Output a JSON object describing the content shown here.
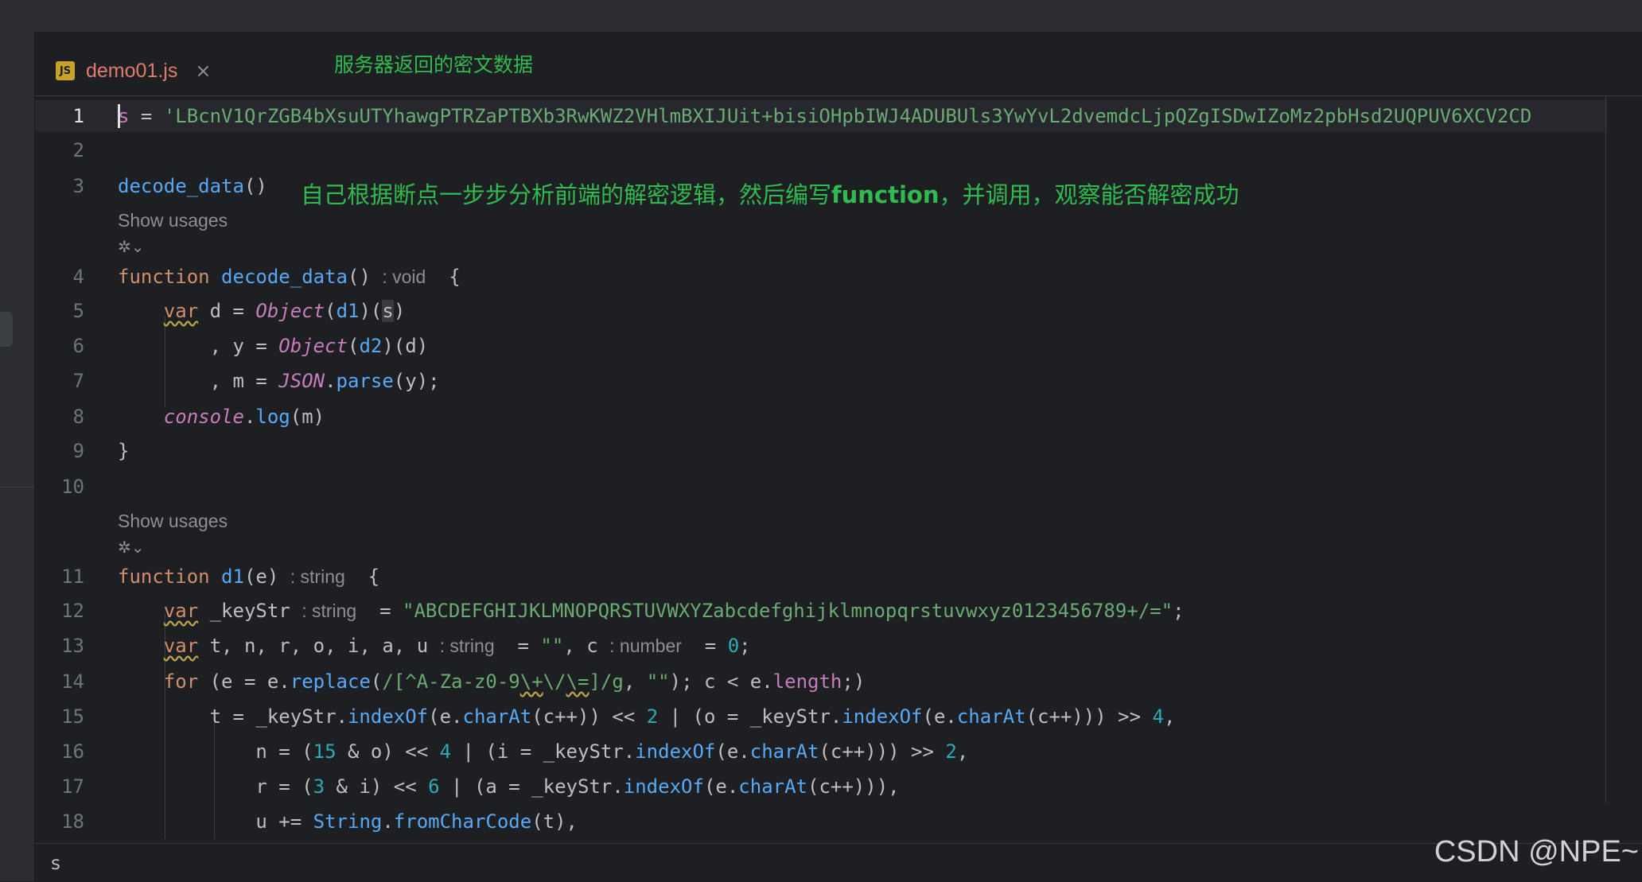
{
  "editor": {
    "tab": {
      "icon": "JS",
      "label": "demo01.js",
      "close": "×"
    },
    "status_text": "s"
  },
  "annotations": {
    "server_data": "服务器返回的密文数据",
    "line3_prefix": "自己根据断点一步步分析前端的解密逻辑，然后编写",
    "line3_bold": "function",
    "line3_suffix": "，并调用，观察能否解密成功"
  },
  "inlays": {
    "show_usages": "Show usages",
    "void": ": void",
    "string": ": string",
    "number": ": number"
  },
  "line_numbers": [
    "1",
    "2",
    "3",
    "4",
    "5",
    "6",
    "7",
    "8",
    "9",
    "10",
    "11",
    "12",
    "13",
    "14",
    "15",
    "16",
    "17",
    "18"
  ],
  "code": {
    "l1_var": "s",
    "l1_str": "'LBcnV1QrZGB4bXsuUTYhawgPTRZaPTBXb3RwKWZ2VHlmBXIJUit+bisiOHpbIWJ4ADUBUls3YwYvL2dvemdcLjpQZgISDwIZoMz2pbHsd2UQPUV6XCV2CD",
    "l3_call": "decode_data",
    "l4_fn": "decode_data",
    "l5_obj": "Object",
    "l5_arg": "d1",
    "l5_s": "s",
    "l6_obj": "Object",
    "l6_arg": "d2",
    "l7_json": "JSON",
    "l7_parse": "parse",
    "l8_console": "console",
    "l8_log": "log",
    "l11_fn": "d1",
    "l12_str": "\"ABCDEFGHIJKLMNOPQRSTUVWXYZabcdefghijklmnopqrstuvwxyz0123456789+/=\"",
    "l13_empty": "\"\"",
    "l13_zero": "0",
    "l14_re1": "/[^A-Za-z0-9",
    "l14_re2": "\\+",
    "l14_re3": "\\/",
    "l14_re4": "\\=",
    "l14_re5": "]/g",
    "l14_empty": "\"\"",
    "n2": "2",
    "n4": "4",
    "n15": "15",
    "n3": "3",
    "n6": "6"
  },
  "watermark": "CSDN @NPE~"
}
